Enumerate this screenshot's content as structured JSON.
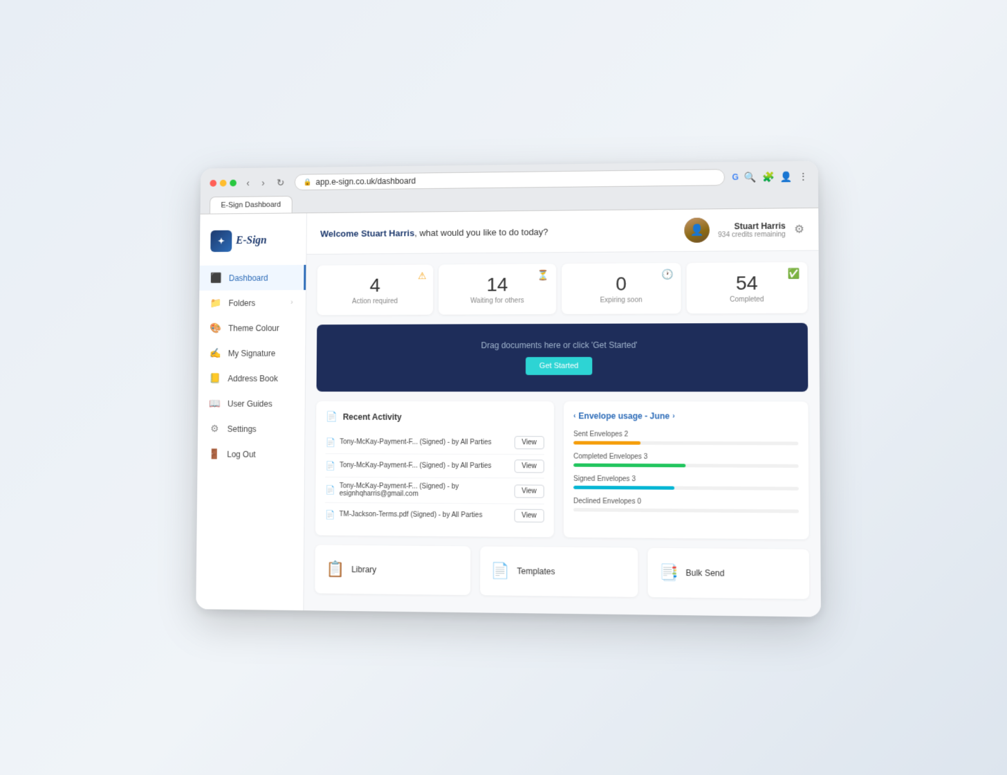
{
  "browser": {
    "url": "app.e-sign.co.uk/dashboard",
    "tab_label": "E-Sign Dashboard"
  },
  "header": {
    "welcome_text": "Welcome Stuart Harris, what would you like to do today?",
    "user_name": "Stuart Harris",
    "user_credits": "934 credits remaining",
    "settings_icon": "⚙"
  },
  "sidebar": {
    "logo_text": "E-Sign",
    "items": [
      {
        "id": "dashboard",
        "label": "Dashboard",
        "icon": "🏠",
        "active": true
      },
      {
        "id": "folders",
        "label": "Folders",
        "icon": "📁",
        "has_chevron": true
      },
      {
        "id": "theme",
        "label": "Theme Colour",
        "icon": "🎨"
      },
      {
        "id": "signature",
        "label": "My Signature",
        "icon": "✍"
      },
      {
        "id": "address",
        "label": "Address Book",
        "icon": "📒"
      },
      {
        "id": "guides",
        "label": "User Guides",
        "icon": "📖"
      },
      {
        "id": "settings",
        "label": "Settings",
        "icon": "⚙"
      },
      {
        "id": "logout",
        "label": "Log Out",
        "icon": "🚪"
      }
    ]
  },
  "stats": [
    {
      "id": "action",
      "number": "4",
      "label": "Action required",
      "badge": "⚠",
      "badge_class": "badge-orange"
    },
    {
      "id": "waiting",
      "number": "14",
      "label": "Waiting for others",
      "badge": "⏳",
      "badge_class": "badge-gray"
    },
    {
      "id": "expiring",
      "number": "0",
      "label": "Expiring soon",
      "badge": "🕐",
      "badge_class": "badge-gray"
    },
    {
      "id": "completed",
      "number": "54",
      "label": "Completed",
      "badge": "✅",
      "badge_class": "badge-green"
    }
  ],
  "upload": {
    "prompt": "Drag documents here or click 'Get Started'",
    "button_label": "Get Started"
  },
  "activity": {
    "title": "Recent Activity",
    "icon": "📄",
    "items": [
      {
        "text": "Tony-McKay-Payment-F... (Signed) - by All Parties",
        "view_label": "View"
      },
      {
        "text": "Tony-McKay-Payment-F... (Signed) - by All Parties",
        "view_label": "View"
      },
      {
        "text": "Tony-McKay-Payment-F... (Signed) - by esignhqharris@gmail.com",
        "view_label": "View"
      },
      {
        "text": "TM-Jackson-Terms.pdf (Signed) - by All Parties",
        "view_label": "View"
      }
    ]
  },
  "envelope_usage": {
    "title": "Envelope usage - June",
    "items": [
      {
        "label": "Sent Envelopes 2",
        "bar_class": "bar-orange",
        "width": "30%"
      },
      {
        "label": "Completed Envelopes 3",
        "bar_class": "bar-green",
        "width": "50%"
      },
      {
        "label": "Signed Envelopes 3",
        "bar_class": "bar-cyan",
        "width": "45%"
      },
      {
        "label": "Declined Envelopes 0",
        "bar_class": "bar-empty",
        "width": "0%"
      }
    ]
  },
  "bottom_panels": [
    {
      "id": "library",
      "label": "Library",
      "icon": "📋"
    },
    {
      "id": "templates",
      "label": "Templates",
      "icon": "📄"
    },
    {
      "id": "bulk-send",
      "label": "Bulk Send",
      "icon": "📑"
    }
  ]
}
